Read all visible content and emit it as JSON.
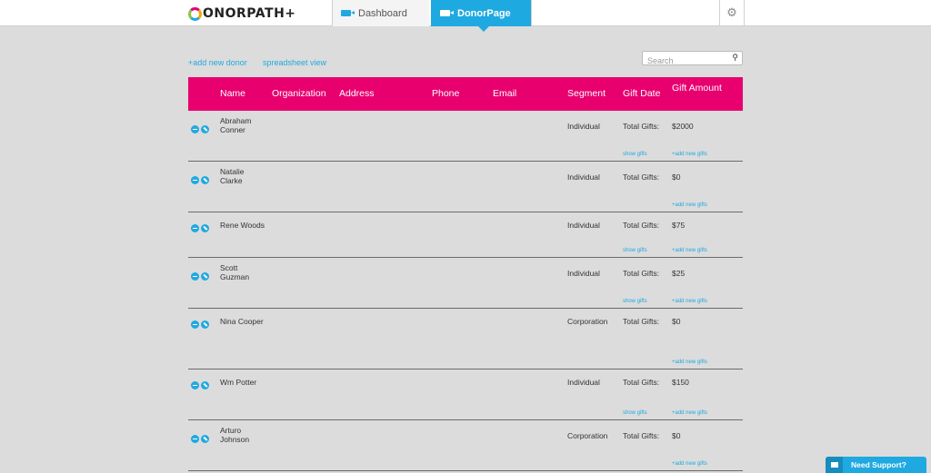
{
  "header": {
    "logo_text": "ONORPATH+",
    "tabs": [
      {
        "label": "Dashboard",
        "active": false
      },
      {
        "label": "DonorPage",
        "active": true
      }
    ],
    "settings_icon": "gear-icon"
  },
  "toolbar": {
    "add_donor_label": "+add new donor",
    "spreadsheet_label": "spreadsheet view",
    "search_placeholder": "Search",
    "search_icon": "magnifier-icon"
  },
  "table": {
    "columns": [
      "Name",
      "Organization",
      "Address",
      "Phone",
      "Email",
      "Segment",
      "Gift Date",
      "Gift Amount"
    ],
    "total_label": "Total Gifts:",
    "show_gifts_label": "show gifts",
    "add_gifts_label": "+add new gifts",
    "rows": [
      {
        "first": "Abraham",
        "last": "Conner",
        "segment": "Individual",
        "amount": "$2000",
        "show_gifts": true
      },
      {
        "first": "Natalie",
        "last": "Clarke",
        "segment": "Individual",
        "amount": "$0",
        "show_gifts": false
      },
      {
        "first": "Rene Woods",
        "last": "",
        "segment": "Individual",
        "amount": "$75",
        "show_gifts": true
      },
      {
        "first": "Scott",
        "last": "Guzman",
        "segment": "Individual",
        "amount": "$25",
        "show_gifts": true
      },
      {
        "first": "Nina Cooper",
        "last": "",
        "segment": "Corporation",
        "amount": "$0",
        "show_gifts": false
      },
      {
        "first": "Wm Potter",
        "last": "",
        "segment": "Individual",
        "amount": "$150",
        "show_gifts": true
      },
      {
        "first": "Arturo",
        "last": "Johnson",
        "segment": "Corporation",
        "amount": "$0",
        "show_gifts": false
      }
    ]
  },
  "support": {
    "label": "Need Support?"
  },
  "colors": {
    "accent": "#1fa9e1",
    "header": "#e8006f",
    "background": "#dcdcdc"
  }
}
